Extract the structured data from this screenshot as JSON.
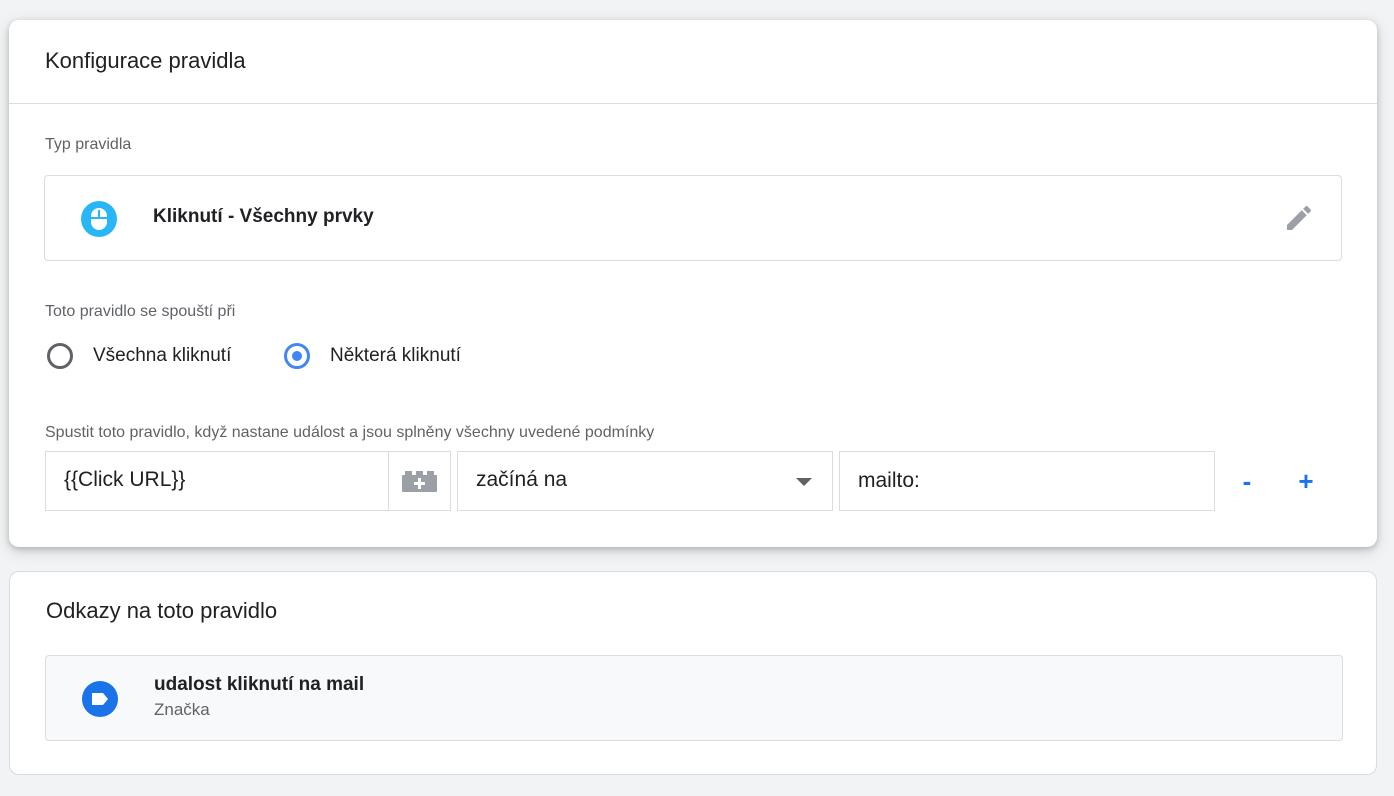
{
  "config_card": {
    "title": "Konfigurace pravidla",
    "type_label": "Typ pravidla",
    "type": {
      "name": "Kliknutí - Všechny prvky",
      "icon": "mouse-icon",
      "icon_color": "#29b6f6",
      "edit_icon": "pencil-icon"
    },
    "fires_on_label": "Toto pravidlo se spouští při",
    "fires_on_options": [
      {
        "label": "Všechna kliknutí",
        "checked": false
      },
      {
        "label": "Některá kliknutí",
        "checked": true
      }
    ],
    "condition_label": "Spustit toto pravidlo, když nastane událost a jsou splněny všechny uvedené podmínky",
    "condition": {
      "variable": "{{Click URL}}",
      "variable_picker_icon": "lego-brick-add-icon",
      "operator": "začíná na",
      "value": "mailto:"
    },
    "remove_label": "-",
    "add_label": "+"
  },
  "refs_card": {
    "title": "Odkazy na toto pravidlo",
    "items": [
      {
        "name": "udalost kliknutí na mail",
        "type": "Značka",
        "icon": "tag-icon",
        "icon_color": "#1a73e8"
      }
    ]
  },
  "colors": {
    "accent": "#1a73e8",
    "radio_accent": "#4285f4",
    "background": "#f1f3f4"
  }
}
